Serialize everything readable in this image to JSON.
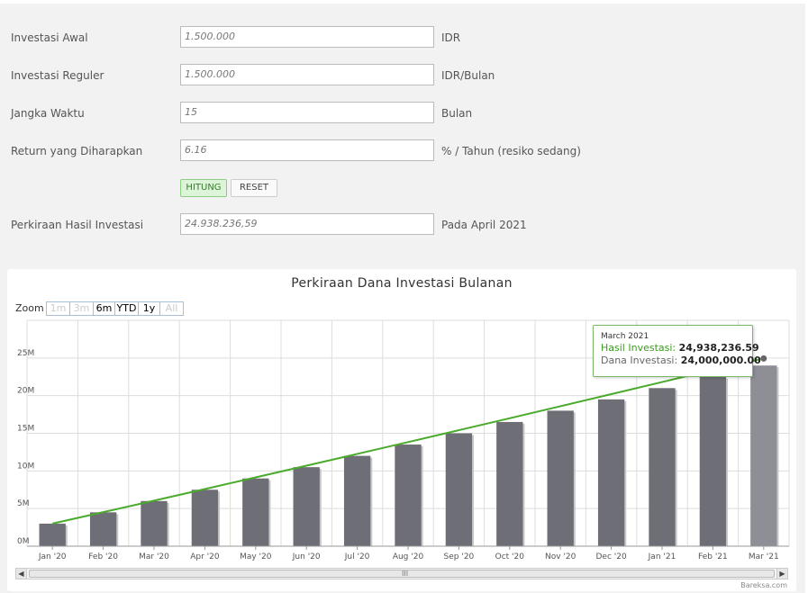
{
  "form": {
    "rows": [
      {
        "label": "Investasi Awal",
        "value": "1.500.000",
        "unit": "IDR"
      },
      {
        "label": "Investasi Reguler",
        "value": "1.500.000",
        "unit": "IDR/Bulan"
      },
      {
        "label": "Jangka Waktu",
        "value": "15",
        "unit": "Bulan"
      },
      {
        "label": "Return yang Diharapkan",
        "value": "6.16",
        "unit": "% / Tahun (resiko sedang)"
      }
    ],
    "hitung_label": "HITUNG",
    "reset_label": "RESET",
    "result": {
      "label": "Perkiraan Hasil Investasi",
      "value": "24.938.236,59",
      "unit": "Pada April 2021"
    }
  },
  "chart": {
    "zoom_label": "Zoom",
    "zoom_buttons": [
      {
        "label": "1m",
        "enabled": false
      },
      {
        "label": "3m",
        "enabled": false
      },
      {
        "label": "6m",
        "enabled": true
      },
      {
        "label": "YTD",
        "enabled": true
      },
      {
        "label": "1y",
        "enabled": true
      },
      {
        "label": "All",
        "enabled": false
      }
    ],
    "tooltip": {
      "title": "March 2021",
      "hasil_label": "Hasil Investasi:",
      "hasil_value": "24,938,236.59",
      "dana_label": "Dana Investasi:",
      "dana_value": "24,000,000.00"
    },
    "credit": "Bareksa.com",
    "scroll_grip": "III",
    "colors": {
      "bar": "#6e6e76",
      "bar_highlight": "#8e8e96",
      "line": "#4aaa2c",
      "grid": "#dddddd",
      "tooltip_green": "#3c9a1e"
    }
  },
  "chart_data": {
    "type": "bar",
    "title": "Perkiraan Dana Investasi Bulanan",
    "categories": [
      "Jan '20",
      "Feb '20",
      "Mar '20",
      "Apr '20",
      "May '20",
      "Jun '20",
      "Jul '20",
      "Aug '20",
      "Sep '20",
      "Oct '20",
      "Nov '20",
      "Dec '20",
      "Jan '21",
      "Feb '21",
      "Mar '21"
    ],
    "series": [
      {
        "name": "Dana Investasi",
        "type": "bar",
        "values": [
          3000000,
          4500000,
          6000000,
          7500000,
          9000000,
          10500000,
          12000000,
          13500000,
          15000000,
          16500000,
          18000000,
          19500000,
          21000000,
          22500000,
          24000000
        ]
      },
      {
        "name": "Hasil Investasi",
        "type": "line",
        "values": [
          3000000,
          4523000,
          6054000,
          7593000,
          9140000,
          10695000,
          12258000,
          13829000,
          15408000,
          16996000,
          18592000,
          20196000,
          21808000,
          23429000,
          24938236.59
        ]
      }
    ],
    "y_ticks": [
      "0M",
      "5M",
      "10M",
      "15M",
      "20M",
      "25M"
    ],
    "ylim": [
      0,
      30000000
    ],
    "grid": true,
    "highlighted_index": 14
  }
}
